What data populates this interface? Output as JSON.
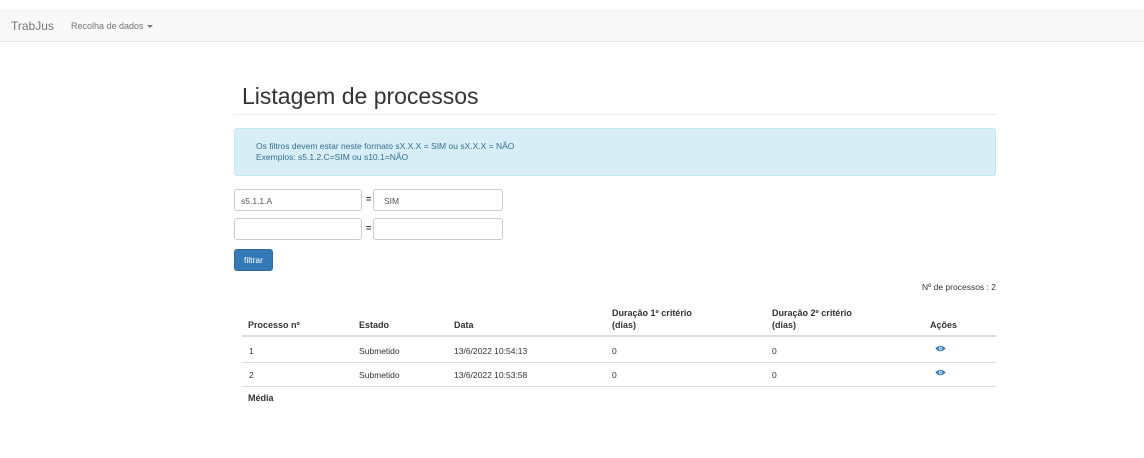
{
  "navbar": {
    "brand": "TrabJus",
    "menu_label": "Recolha de dados"
  },
  "page": {
    "title": "Listagem de processos"
  },
  "alert": {
    "line1": "Os filtros devem estar neste formato sX.X.X = SIM ou sX.X.X = NÃO",
    "line2": "Exemplos: s5.1.2.C=SIM ou s10.1=NÃO"
  },
  "filters": [
    {
      "key": "s5.1.1.A",
      "eq": "=",
      "value": "SIM"
    },
    {
      "key": "",
      "eq": "=",
      "value": ""
    }
  ],
  "filter_button": "filtrar",
  "count_label": "Nº de processos : 2",
  "table": {
    "headers": {
      "processo": "Processo nº",
      "estado": "Estado",
      "data": "Data",
      "dur1_a": "Duração 1º critério",
      "dur1_b": "(dias)",
      "dur2_a": "Duração 2º critério",
      "dur2_b": "(dias)",
      "acoes": "Ações"
    },
    "rows": [
      {
        "processo": "1",
        "estado": "Submetido",
        "data": "13/6/2022 10:54:13",
        "dur1": "0",
        "dur2": "0",
        "action_icon": "eye-icon"
      },
      {
        "processo": "2",
        "estado": "Submetido",
        "data": "13/6/2022 10:53:58",
        "dur1": "0",
        "dur2": "0",
        "action_icon": "eye-icon"
      }
    ],
    "footer_label": "Média"
  },
  "colors": {
    "primary": "#337ab7",
    "alert_bg": "#d9edf7",
    "alert_text": "#31708f"
  }
}
